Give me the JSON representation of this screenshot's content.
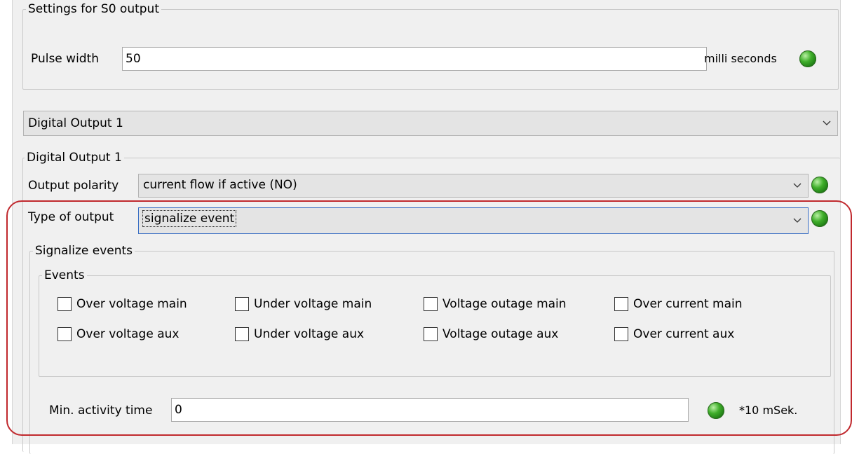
{
  "s0": {
    "legend": "Settings for S0 output",
    "pulse_width_label": "Pulse width",
    "pulse_width_value": "50",
    "unit": "milli seconds"
  },
  "output_selector": {
    "selected": "Digital Output 1"
  },
  "digital_output": {
    "legend": "Digital Output 1",
    "polarity_label": "Output polarity",
    "polarity_value": "current flow if active (NO)",
    "type_label": "Type of output",
    "type_value": "signalize event"
  },
  "signalize": {
    "legend": "Signalize events",
    "events_legend": "Events",
    "events": [
      {
        "label": "Over voltage main",
        "checked": false
      },
      {
        "label": "Under voltage main",
        "checked": false
      },
      {
        "label": "Voltage outage main",
        "checked": false
      },
      {
        "label": "Over current main",
        "checked": false
      },
      {
        "label": "Over voltage aux",
        "checked": false
      },
      {
        "label": "Under voltage aux",
        "checked": false
      },
      {
        "label": "Voltage outage aux",
        "checked": false
      },
      {
        "label": "Over current aux",
        "checked": false
      }
    ],
    "min_activity_label": "Min. activity time",
    "min_activity_value": "0",
    "min_activity_unit": "*10 mSek."
  },
  "colors": {
    "status_led": "#2e9a1f",
    "highlight": "#c0282d",
    "focus_border": "#3a6fc4"
  },
  "icons": {
    "dropdown": "chevron-down-icon",
    "status": "status-led-icon"
  }
}
